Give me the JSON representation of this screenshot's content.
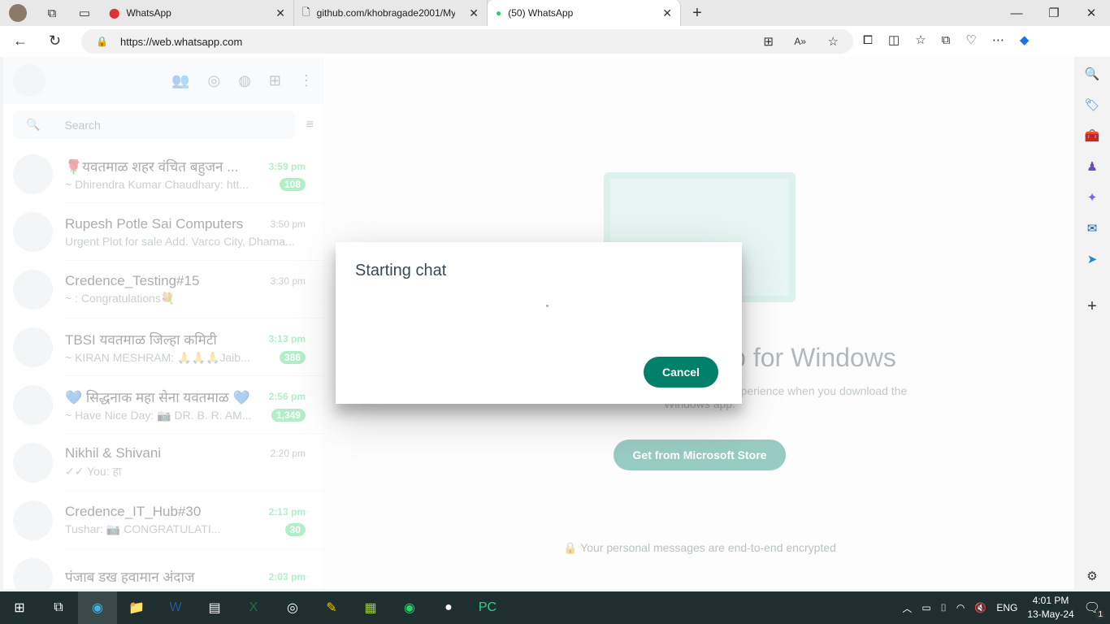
{
  "browser": {
    "tabs": [
      {
        "title": "WhatsApp",
        "icon": "alert-icon"
      },
      {
        "title": "github.com/khobragade2001/My",
        "icon": "page-icon"
      },
      {
        "title": "(50) WhatsApp",
        "icon": "whatsapp-icon"
      }
    ],
    "url": "https://web.whatsapp.com"
  },
  "whatsapp": {
    "search_placeholder": "Search",
    "chats": [
      {
        "name": "🌹यवतमाळ शहर वंचित बहुजन ...",
        "time": "3:59 pm",
        "msg": "~ Dhirendra Kumar Chaudhary: htt...",
        "badge": "108",
        "unread": true
      },
      {
        "name": "Rupesh Potle Sai Computers",
        "time": "3:50 pm",
        "msg": "Urgent Plot for sale  Add. Varco City, Dhama...",
        "badge": "",
        "unread": false
      },
      {
        "name": "Credence_Testing#15",
        "time": "3:30 pm",
        "msg": "~  : Congratulations💐",
        "badge": "",
        "unread": false
      },
      {
        "name": "TBSI यवतमाळ जिल्हा कमिटी",
        "time": "3:13 pm",
        "msg": "~ KIRAN MESHRAM: 🙏🙏🙏Jaib...",
        "badge": "386",
        "unread": true
      },
      {
        "name": "💙 सिद्धनाक महा सेना यवतमाळ 💙",
        "time": "2:56 pm",
        "msg": "~ Have Nice Day: 📷 DR. B. R. AM...",
        "badge": "1,349",
        "unread": true
      },
      {
        "name": "Nikhil & Shivani",
        "time": "2:20 pm",
        "msg": "✓✓ You: हा",
        "badge": "",
        "unread": false
      },
      {
        "name": "Credence_IT_Hub#30",
        "time": "2:13 pm",
        "msg": "Tushar: 📷 CONGRATULATI...",
        "badge": "30",
        "unread": true
      },
      {
        "name": "पंजाब डख हवामान अंदाज",
        "time": "2:03 pm",
        "msg": "",
        "badge": "",
        "unread": true
      }
    ],
    "intro": {
      "title": "Download WhatsApp for Windows",
      "text": "Make calls, share your screen and get a faster experience when you download the Windows app.",
      "button": "Get from Microsoft Store",
      "footer": "Your personal messages are end-to-end encrypted"
    }
  },
  "modal": {
    "title": "Starting chat",
    "cancel": "Cancel"
  },
  "taskbar": {
    "lang": "ENG",
    "time": "4:01 PM",
    "date": "13-May-24",
    "notifications": "1"
  }
}
